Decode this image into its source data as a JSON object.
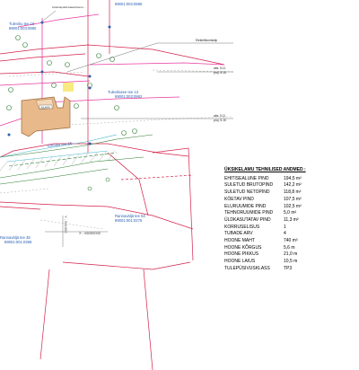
{
  "parcels": {
    "top_left": {
      "name": "Tuleviku tee 16",
      "code": "89001:003:0980"
    },
    "top_right": {
      "name": "89001:003:0985"
    },
    "center": {
      "name": "Tulevikutee tee 13",
      "code": "89001:003:0982"
    },
    "corridor": {
      "name": "Tuleviku tee 15"
    },
    "lower_right": {
      "name": "Rannaväljä tee 53",
      "code": "89001:001:0275"
    },
    "lower_left": {
      "name": "Rannaväljä tee 48",
      "code": "89001:001:0358"
    }
  },
  "annotations": {
    "utility_note": "Liitumispunkt\nkasvuhoonu ...",
    "elektri": "Elektriliitumiskilp",
    "elev1": "abs. 5.11",
    "elev1b": "proj. 5.15",
    "elev2": "abs. 5.11",
    "elev2b": "proj. 5.15",
    "coord_x": "X - 66050000",
    "coord_y": "Y - 541000",
    "building_label": "ELAMU"
  },
  "tech_table": {
    "title": "ÜKSIKELAMU TEHNILISED ANDMED :",
    "rows": [
      {
        "label": "EHITISEALUNE PIND",
        "value": "194,5 m²"
      },
      {
        "label": "SULETUD BRUTOPIND",
        "value": "142,2 m²"
      },
      {
        "label": "SULETUD NETOPIND",
        "value": "118,8 m²"
      },
      {
        "label": "KÖETAV PIND",
        "value": "107,5 m²"
      },
      {
        "label": "ELURUUMIDE PIND",
        "value": "102,5 m²"
      },
      {
        "label": "TEHNORUUMIDE PIND",
        "value": "5,0 m²"
      },
      {
        "label": "ÜLDKASUTATAV PIND",
        "value": "11,3 m²"
      },
      {
        "label": "KORRUSELISUS",
        "value": "1"
      },
      {
        "label": "TUBADE ARV",
        "value": "4"
      },
      {
        "label": "HOONE MAHT",
        "value": "740 m³"
      },
      {
        "label": "HOONE KÕRGUS",
        "value": "5,6 m"
      },
      {
        "label": "HOONE PIKKUS",
        "value": "21,0 m"
      },
      {
        "label": "HOONE LAIUS",
        "value": "10,5 m"
      },
      {
        "label": "TULEPÜSIVUSKLASS",
        "value": "TP3"
      }
    ]
  },
  "colors": {
    "parcel_line": "#d4204a",
    "road_line": "#2e7d32",
    "magenta": "#e83aa0",
    "building_fill": "#e8b98a",
    "cyan": "#3fb6c6",
    "blue_text": "#2a5fb0"
  }
}
